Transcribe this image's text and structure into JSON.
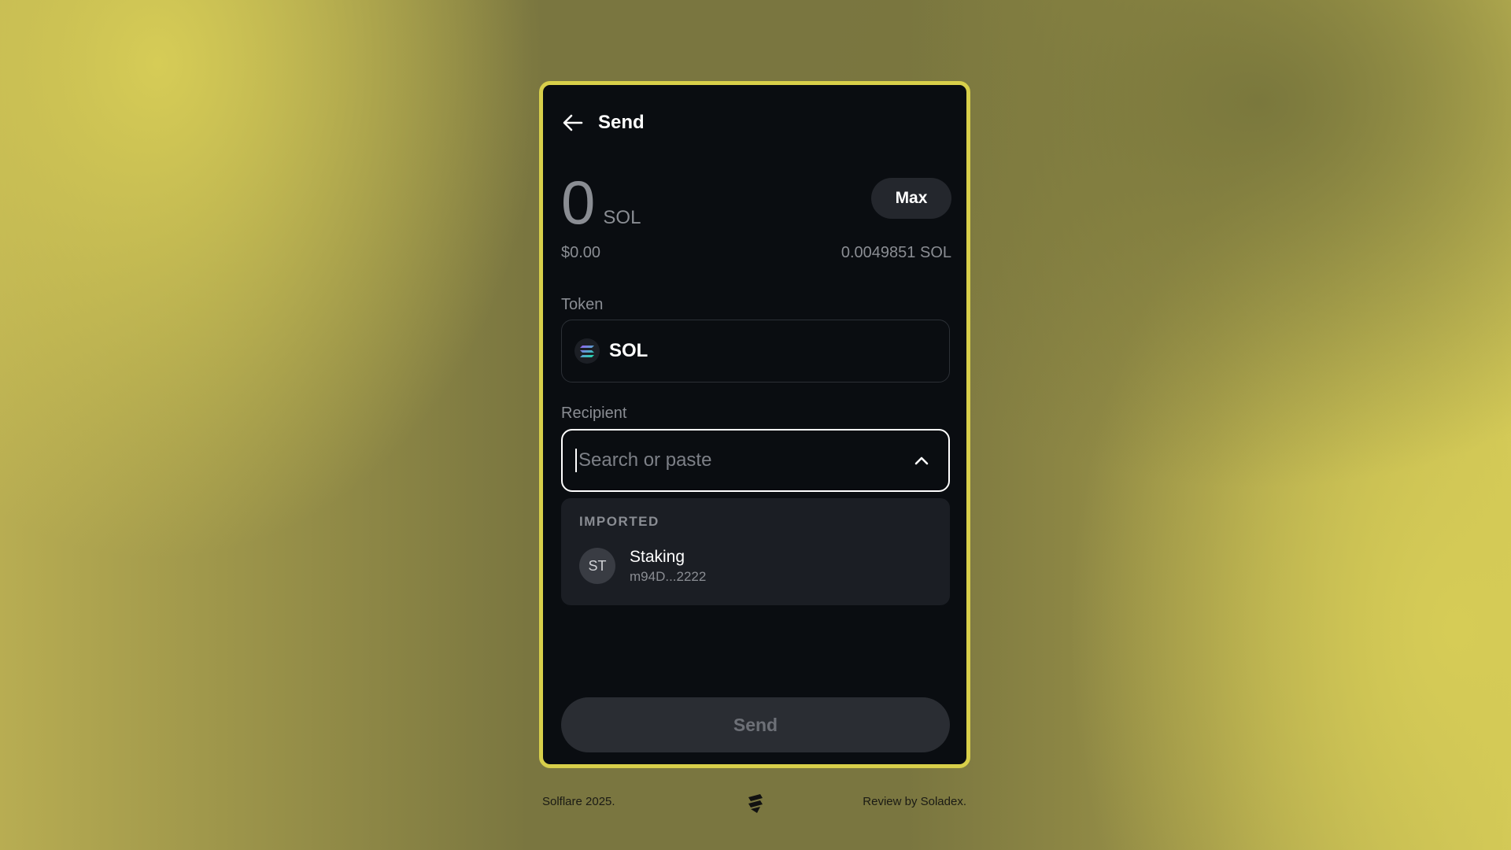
{
  "header": {
    "title": "Send",
    "back_icon": "arrow-left-icon"
  },
  "amount": {
    "value": "0",
    "unit": "SOL",
    "fiat": "$0.00",
    "balance": "0.0049851 SOL",
    "max_label": "Max"
  },
  "token": {
    "label": "Token",
    "selected": "SOL",
    "icon": "solana-logo-icon"
  },
  "recipient": {
    "label": "Recipient",
    "value": "",
    "placeholder": "Search or paste",
    "toggle_icon": "chevron-up-icon"
  },
  "dropdown": {
    "section_title": "IMPORTED",
    "contacts": [
      {
        "initials": "ST",
        "name": "Staking",
        "address": "m94D...2222"
      }
    ]
  },
  "send_button": {
    "label": "Send"
  },
  "footer": {
    "left": "Solflare 2025.",
    "right": "Review by Soladex.",
    "logo_icon": "solflare-logo-icon"
  },
  "colors": {
    "accent_border": "#d8cf4a",
    "panel_bg": "#0a0d11",
    "muted_text": "#8a8d93"
  }
}
